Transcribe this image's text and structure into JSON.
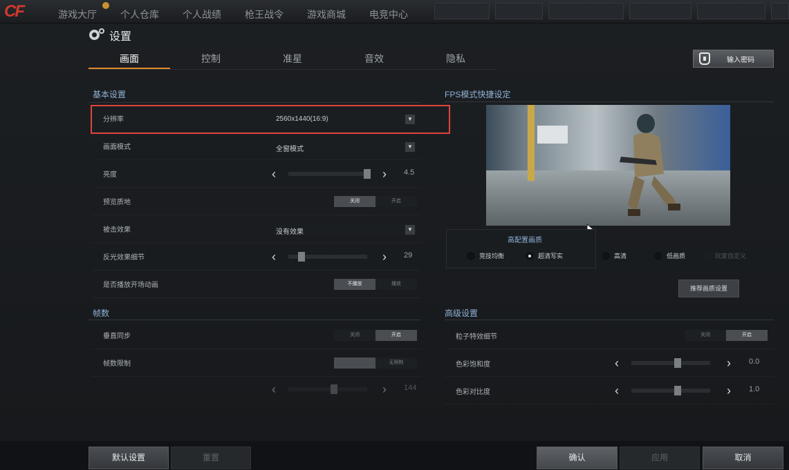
{
  "topbar": {
    "logo": "CF",
    "nav": [
      "游戏大厅",
      "个人仓库",
      "个人战绩",
      "枪王战令",
      "游戏商城",
      "电竞中心"
    ]
  },
  "panel": {
    "title": "设置",
    "tabs": [
      "画面",
      "控制",
      "准星",
      "音效",
      "隐私"
    ],
    "active_tab": "画面",
    "password_button": "输入密码"
  },
  "basic": {
    "heading": "基本设置",
    "resolution": {
      "label": "分辨率",
      "value": "2560x1440(16:9)"
    },
    "display_mode": {
      "label": "画面模式",
      "value": "全窗模式"
    },
    "brightness": {
      "label": "亮度",
      "value": "4.5"
    },
    "preview_texture": {
      "label": "预览质地",
      "off": "关闭",
      "on": "开启",
      "selected": "off"
    },
    "hit_effect": {
      "label": "被击效果",
      "value": "没有效果"
    },
    "reflection": {
      "label": "反光效果细节",
      "value": "29"
    },
    "intro_anim": {
      "label": "是否播放开场动画",
      "no": "不播放",
      "yes": "播放",
      "selected": "no"
    }
  },
  "framerate": {
    "heading": "帧数",
    "vsync": {
      "label": "垂直同步",
      "off": "关闭",
      "on": "开启",
      "selected": "on"
    },
    "limit": {
      "label": "帧数限制",
      "unlimited": "无限制"
    },
    "limit_value": "144"
  },
  "fps": {
    "heading": "FPS模式快捷设定",
    "quality_title": "高配置画质",
    "options": [
      {
        "label": "竞技均衡",
        "selected": false,
        "dim": false
      },
      {
        "label": "超清写实",
        "selected": true,
        "dim": false
      },
      {
        "label": "高清",
        "selected": false,
        "dim": false
      },
      {
        "label": "低画质",
        "selected": false,
        "dim": false
      },
      {
        "label": "玩家自定义",
        "selected": false,
        "dim": true
      }
    ],
    "recommend_button": "推荐画质设置"
  },
  "advanced": {
    "heading": "高级设置",
    "particle": {
      "label": "粒子特效细节",
      "off": "关闭",
      "on": "开启",
      "selected": "on"
    },
    "saturation": {
      "label": "色彩饱和度",
      "value": "0.0"
    },
    "contrast": {
      "label": "色彩对比度",
      "value": "1.0"
    }
  },
  "bottom": {
    "default": "默认设置",
    "reset": "重置",
    "confirm": "确认",
    "apply": "应用",
    "cancel": "取消"
  },
  "colors": {
    "accent": "#e08a2c",
    "highlight": "#e0453a",
    "section": "#8fb2d6"
  }
}
